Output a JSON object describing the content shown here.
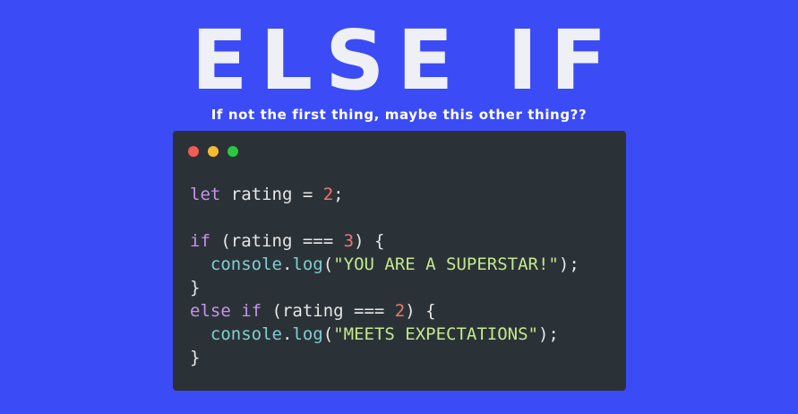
{
  "header": {
    "title": "ELSE IF",
    "subtitle": "If not the first thing, maybe this other thing??"
  },
  "editor": {
    "window_dots": [
      "red-dot",
      "yellow-dot",
      "green-dot"
    ],
    "colors": {
      "background": "#3b4cf6",
      "editor_bg": "#2b3237",
      "dot_red": "#f45b55",
      "dot_yellow": "#f5bc2f",
      "dot_green": "#2ac840",
      "keyword": "#c792ea",
      "number": "#f0756f",
      "function": "#7fcfcf",
      "string": "#c3e88d"
    },
    "code": {
      "l1": {
        "kw": "let",
        "text": " rating = ",
        "num": "2",
        "end": ";"
      },
      "l3": {
        "kw": "if",
        "open": " (rating === ",
        "num": "3",
        "close": ") {"
      },
      "l4": {
        "indent": "  ",
        "obj": "console",
        "dot": ".",
        "method": "log",
        "open": "(",
        "str": "\"YOU ARE A SUPERSTAR!\"",
        "close": ");"
      },
      "l5": {
        "text": "}"
      },
      "l6": {
        "kw": "else if",
        "open": " (rating === ",
        "num": "2",
        "close": ") {"
      },
      "l7": {
        "indent": "  ",
        "obj": "console",
        "dot": ".",
        "method": "log",
        "open": "(",
        "str": "\"MEETS EXPECTATIONS\"",
        "close": ");"
      },
      "l8": {
        "text": "}"
      }
    }
  }
}
